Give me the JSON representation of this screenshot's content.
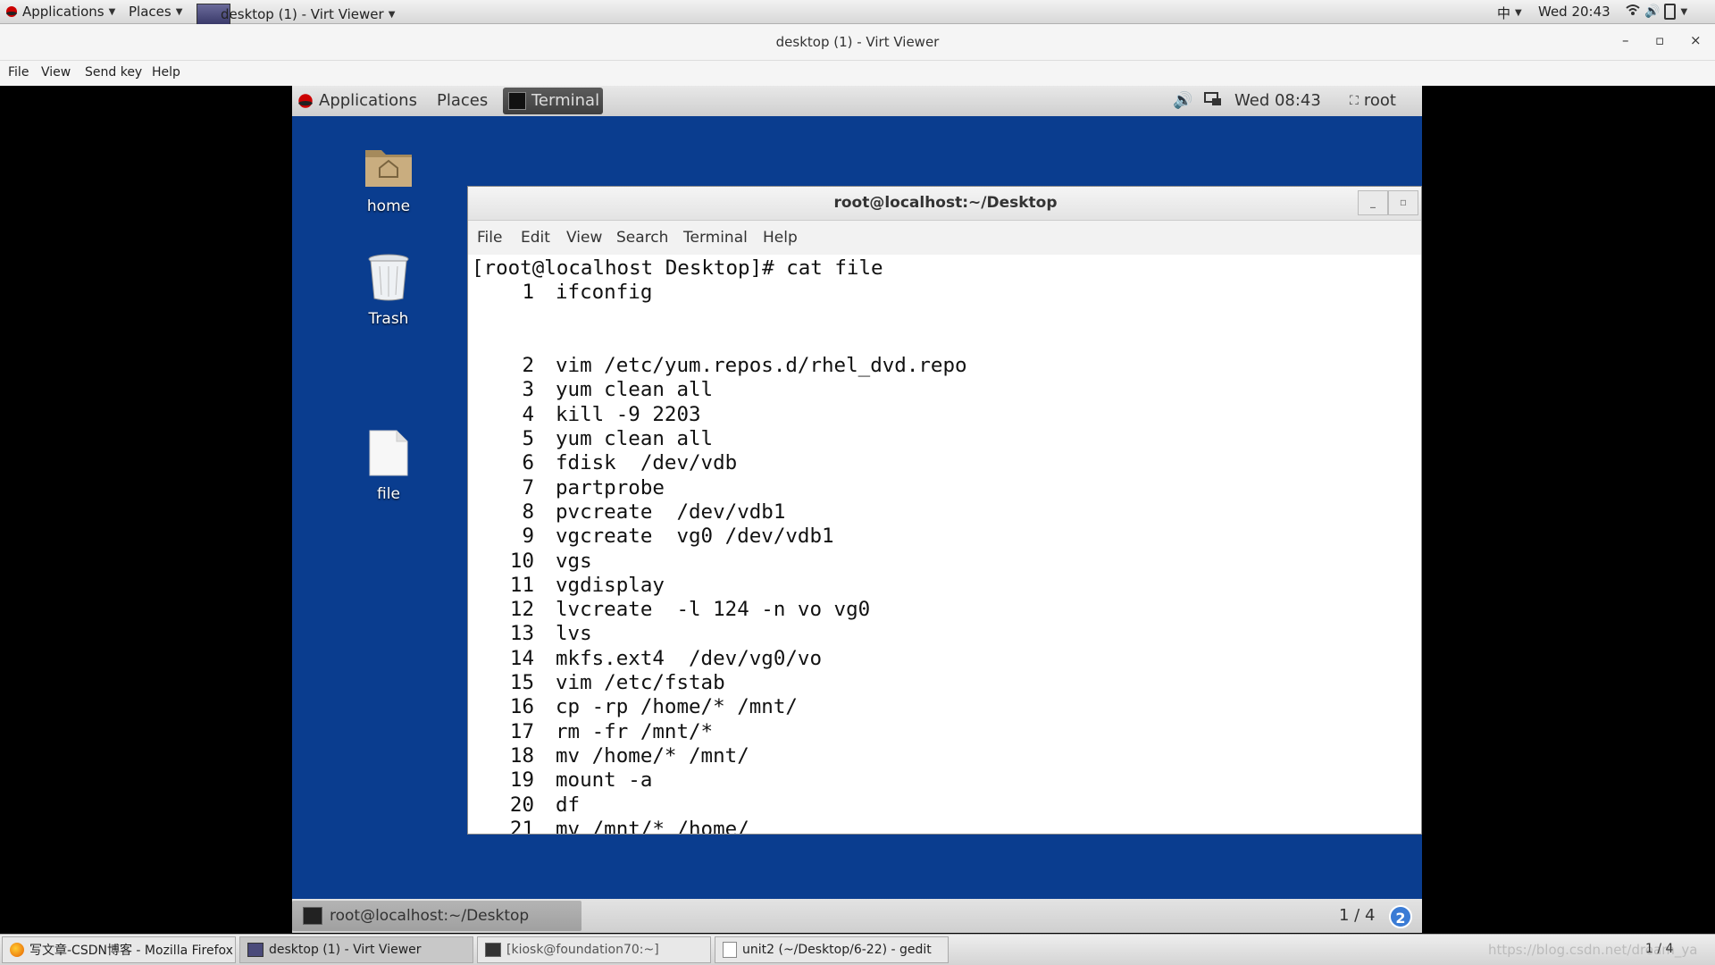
{
  "host_panel": {
    "applications": "Applications",
    "places": "Places",
    "active_window": "desktop (1) - Virt Viewer",
    "input_method": "中",
    "clock": "Wed 20:43"
  },
  "viewer": {
    "title": "desktop (1) - Virt Viewer",
    "menu": [
      "File",
      "View",
      "Send key",
      "Help"
    ]
  },
  "guest_panel": {
    "applications": "Applications",
    "places": "Places",
    "terminal": "Terminal",
    "clock": "Wed 08:43",
    "user": "root"
  },
  "desktop_icons": [
    {
      "label": "home",
      "icon": "folder-home-icon"
    },
    {
      "label": "Trash",
      "icon": "trash-icon"
    },
    {
      "label": "file",
      "icon": "file-icon"
    }
  ],
  "terminal": {
    "title": "root@localhost:~/Desktop",
    "menu": [
      "File",
      "Edit",
      "View",
      "Search",
      "Terminal",
      "Help"
    ],
    "prompt": "[root@localhost Desktop]# cat file",
    "lines": [
      {
        "n": "1",
        "cmd": "ifconfig"
      },
      {
        "n": "",
        "cmd": ""
      },
      {
        "n": "",
        "cmd": ""
      },
      {
        "n": "2",
        "cmd": "vim /etc/yum.repos.d/rhel_dvd.repo"
      },
      {
        "n": "3",
        "cmd": "yum clean all"
      },
      {
        "n": "4",
        "cmd": "kill -9 2203"
      },
      {
        "n": "5",
        "cmd": "yum clean all"
      },
      {
        "n": "6",
        "cmd": "fdisk  /dev/vdb"
      },
      {
        "n": "7",
        "cmd": "partprobe"
      },
      {
        "n": "8",
        "cmd": "pvcreate  /dev/vdb1"
      },
      {
        "n": "9",
        "cmd": "vgcreate  vg0 /dev/vdb1"
      },
      {
        "n": "10",
        "cmd": "vgs"
      },
      {
        "n": "11",
        "cmd": "vgdisplay"
      },
      {
        "n": "12",
        "cmd": "lvcreate  -l 124 -n vo vg0"
      },
      {
        "n": "13",
        "cmd": "lvs"
      },
      {
        "n": "14",
        "cmd": "mkfs.ext4  /dev/vg0/vo"
      },
      {
        "n": "15",
        "cmd": "vim /etc/fstab"
      },
      {
        "n": "16",
        "cmd": "cp -rp /home/* /mnt/"
      },
      {
        "n": "17",
        "cmd": "rm -fr /mnt/*"
      },
      {
        "n": "18",
        "cmd": "mv /home/* /mnt/"
      },
      {
        "n": "19",
        "cmd": "mount -a"
      },
      {
        "n": "20",
        "cmd": "df"
      },
      {
        "n": "21",
        "cmd": "mv /mnt/* /home/"
      }
    ]
  },
  "guest_bottom": {
    "task": "root@localhost:~/Desktop",
    "workspace": "1 / 4",
    "help": "2"
  },
  "host_taskbar": {
    "items": [
      {
        "label": "写文章-CSDN博客 - Mozilla Firefox",
        "icon": "firefox-icon"
      },
      {
        "label": "desktop (1) - Virt Viewer",
        "icon": "virt-viewer-icon"
      },
      {
        "label": "[kiosk@foundation70:~]",
        "icon": "terminal-icon"
      },
      {
        "label": "unit2 (~/Desktop/6-22) - gedit",
        "icon": "gedit-icon"
      }
    ],
    "watermark": "https://blog.csdn.net/dream_ya",
    "pager": "1 / 4"
  }
}
